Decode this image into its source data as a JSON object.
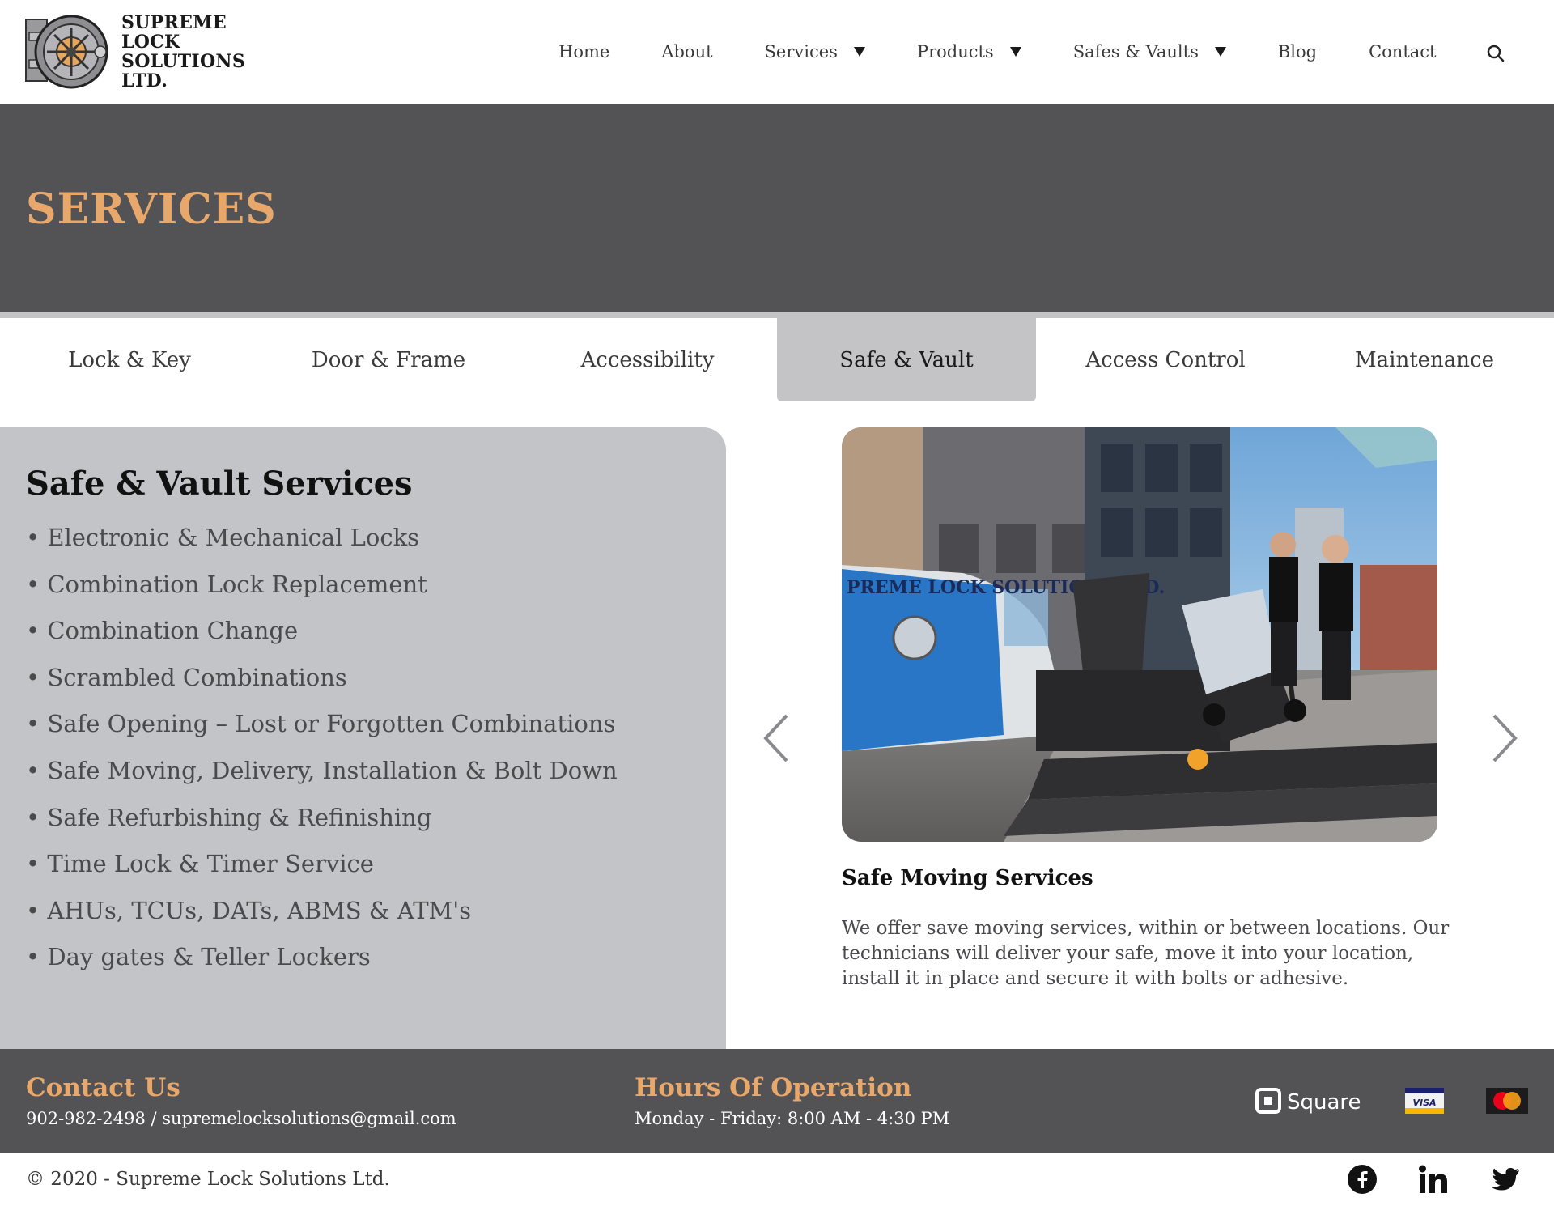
{
  "brand": {
    "line1": "SUPREME LOCK",
    "line2": "SOLUTIONS LTD."
  },
  "nav": {
    "items": [
      {
        "label": "Home",
        "dropdown": false
      },
      {
        "label": "About",
        "dropdown": false
      },
      {
        "label": "Services",
        "dropdown": true
      },
      {
        "label": "Products",
        "dropdown": true
      },
      {
        "label": "Safes & Vaults",
        "dropdown": true
      },
      {
        "label": "Blog",
        "dropdown": false
      },
      {
        "label": "Contact",
        "dropdown": false
      }
    ],
    "search_icon": "search-icon"
  },
  "hero": {
    "title": "SERVICES"
  },
  "tabs": [
    {
      "label": "Lock & Key",
      "active": false
    },
    {
      "label": "Door & Frame",
      "active": false
    },
    {
      "label": "Accessibility",
      "active": false
    },
    {
      "label": "Safe & Vault",
      "active": true
    },
    {
      "label": "Access Control",
      "active": false
    },
    {
      "label": "Maintenance",
      "active": false
    }
  ],
  "panel": {
    "title": "Safe & Vault Services",
    "items": [
      "Electronic & Mechanical Locks",
      "Combination Lock Replacement",
      "Combination Change",
      "Scrambled Combinations",
      "Safe Opening – Lost or Forgotten Combinations",
      "Safe Moving, Delivery, Installation & Bolt Down",
      "Safe Refurbishing & Refinishing",
      "Time Lock & Timer Service",
      "AHUs, TCUs, DATs, ABMS & ATM's",
      "Day gates & Teller Lockers"
    ]
  },
  "carousel": {
    "slide_title": "Safe Moving Services",
    "slide_desc": "We offer save moving services, within or between locations. Our technicians will deliver your safe, move it into your location, install it in place and secure it with bolts or adhesive.",
    "van_text": "PREME LOCK SOLUTIONS LTD."
  },
  "footer": {
    "contact_heading": "Contact Us",
    "contact_text": "902-982-2498 / supremelocksolutions@gmail.com",
    "hours_heading": "Hours Of Operation",
    "hours_text": "Monday - Friday: 8:00 AM - 4:30 PM",
    "payments": {
      "square": "Square",
      "visa": "VISA"
    }
  },
  "bottom": {
    "copyright": "© 2020 - Supreme Lock Solutions Ltd.",
    "social": [
      "facebook-icon",
      "linkedin-icon",
      "twitter-icon"
    ]
  },
  "colors": {
    "accent": "#e8a86b",
    "dark": "#535356",
    "panel": "#c3c4c7"
  }
}
